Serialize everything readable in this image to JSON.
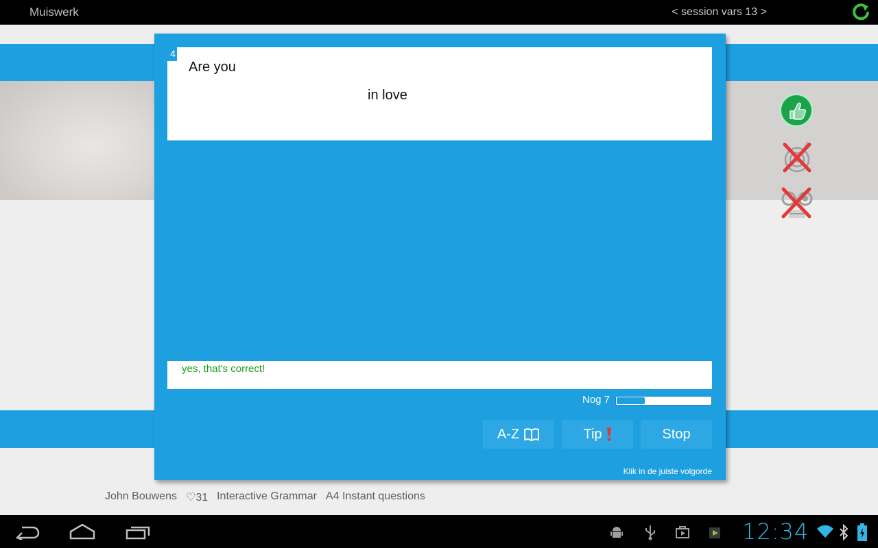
{
  "app": {
    "title": "Muiswerk",
    "session_nav": "< session vars 13 >"
  },
  "icons": {
    "refresh": "refresh-icon",
    "thumbs_up": "thumbs-up-icon",
    "target_disabled": "target-disabled-icon",
    "filter_disabled": "filter-disabled-icon",
    "book": "book-icon",
    "exclamation": "exclamation-icon"
  },
  "footer": {
    "author": "John Bouwens",
    "likes": "♡31",
    "course": "Interactive Grammar",
    "module": "A4 Instant questions"
  },
  "dialog": {
    "question_number": "4",
    "question_line1": "Are you",
    "question_line2": "in love",
    "feedback": "yes, that's correct!",
    "remaining_label": "Nog 7",
    "progress_fraction": 0.3,
    "buttons": {
      "az": "A-Z",
      "tip": "Tip",
      "stop": "Stop"
    },
    "instruction": "Klik in de juiste volgorde"
  },
  "system": {
    "clock": "12:34"
  },
  "colors": {
    "accent": "#1e9fdf",
    "success": "#1a9b1a",
    "clock": "#33b5e5"
  }
}
